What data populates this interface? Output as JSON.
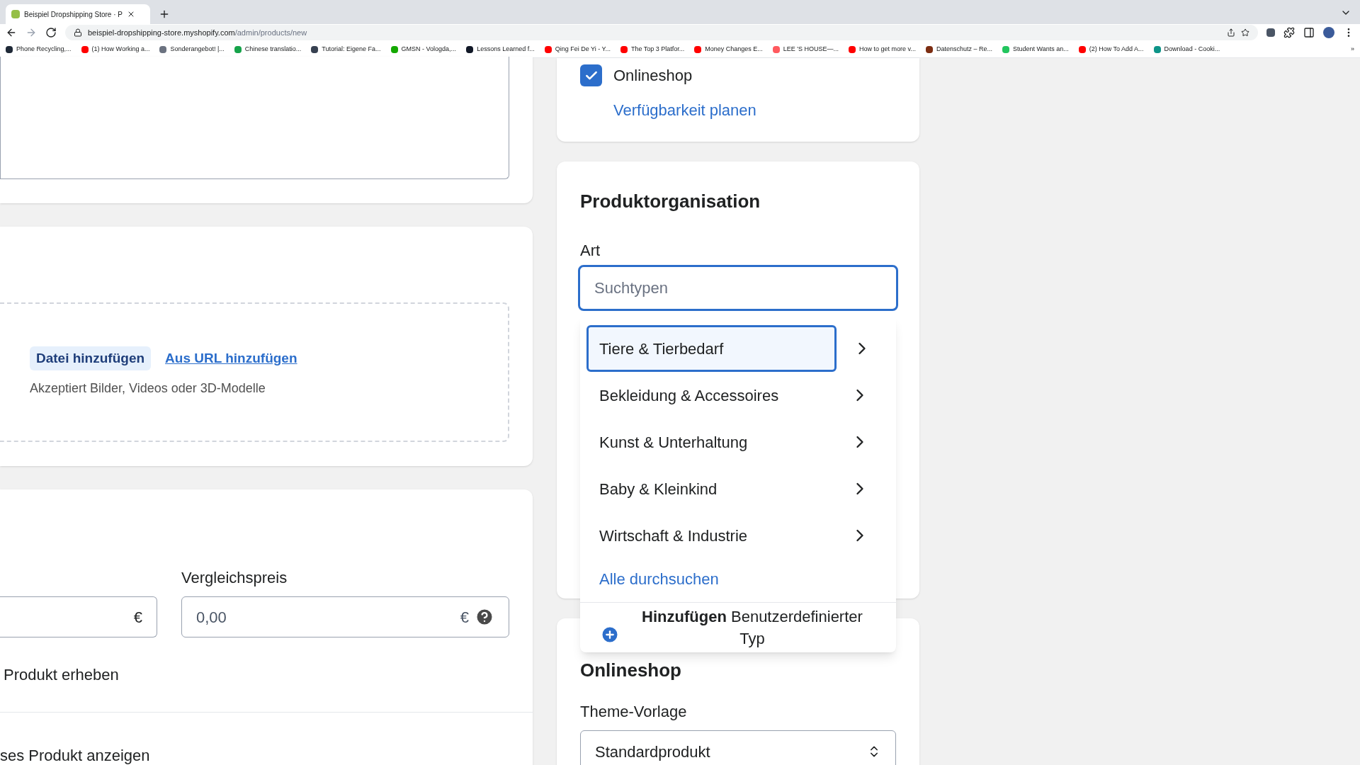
{
  "browser": {
    "tab_title": "Beispiel Dropshipping Store · P",
    "url_host": "beispiel-dropshipping-store.myshopify.com",
    "url_path": "/admin/products/new",
    "bookmarks": [
      {
        "label": "Phone Recycling,...",
        "color": "#1f2937"
      },
      {
        "label": "(1) How Working a...",
        "color": "#ff0000"
      },
      {
        "label": "Sonderangebot! |...",
        "color": "#6b7280"
      },
      {
        "label": "Chinese translatio...",
        "color": "#16a34a"
      },
      {
        "label": "Tutorial: Eigene Fa...",
        "color": "#374151"
      },
      {
        "label": "GMSN - Vologda,...",
        "color": "#14a800"
      },
      {
        "label": "Lessons Learned f...",
        "color": "#111827"
      },
      {
        "label": "Qing Fei De Yi - Y...",
        "color": "#ff0000"
      },
      {
        "label": "The Top 3 Platfor...",
        "color": "#ff0000"
      },
      {
        "label": "Money Changes E...",
        "color": "#ff0000"
      },
      {
        "label": "LEE 'S HOUSE—...",
        "color": "#ff5a5f"
      },
      {
        "label": "How to get more v...",
        "color": "#ff0000"
      },
      {
        "label": "Datenschutz – Re...",
        "color": "#7c2d12"
      },
      {
        "label": "Student Wants an...",
        "color": "#22c55e"
      },
      {
        "label": "(2) How To Add A...",
        "color": "#ff0000"
      },
      {
        "label": "Download - Cooki...",
        "color": "#0d9488"
      }
    ],
    "more": "»"
  },
  "media": {
    "add_file": "Datei hinzufügen",
    "add_url": "Aus URL hinzufügen",
    "hint": "Akzeptiert Bilder, Videos oder 3D-Modelle"
  },
  "pricing": {
    "price_currency": "€",
    "compare_label": "Vergleichspreis",
    "compare_value": "0,00",
    "compare_currency": "€",
    "tax_text": "Produkt erheben",
    "show_text": "ses Produkt anzeigen"
  },
  "sales_channel": {
    "label": "Onlineshop",
    "checked": true,
    "link": "Verfügbarkeit planen"
  },
  "organization": {
    "title": "Produktorganisation",
    "type_label": "Art",
    "type_placeholder": "Suchtypen",
    "options": [
      {
        "label": "Tiere & Tierbedarf",
        "selected": true
      },
      {
        "label": "Bekleidung & Accessoires",
        "selected": false
      },
      {
        "label": "Kunst & Unterhaltung",
        "selected": false
      },
      {
        "label": "Baby & Kleinkind",
        "selected": false
      },
      {
        "label": "Wirtschaft & Industrie",
        "selected": false
      }
    ],
    "browse_all": "Alle durchsuchen",
    "add_custom": "**Hinzufügen** Benutzerdefinierter Typ"
  },
  "online_store": {
    "title": "Onlineshop",
    "theme_label": "Theme-Vorlage",
    "theme_value": "Standardprodukt"
  }
}
